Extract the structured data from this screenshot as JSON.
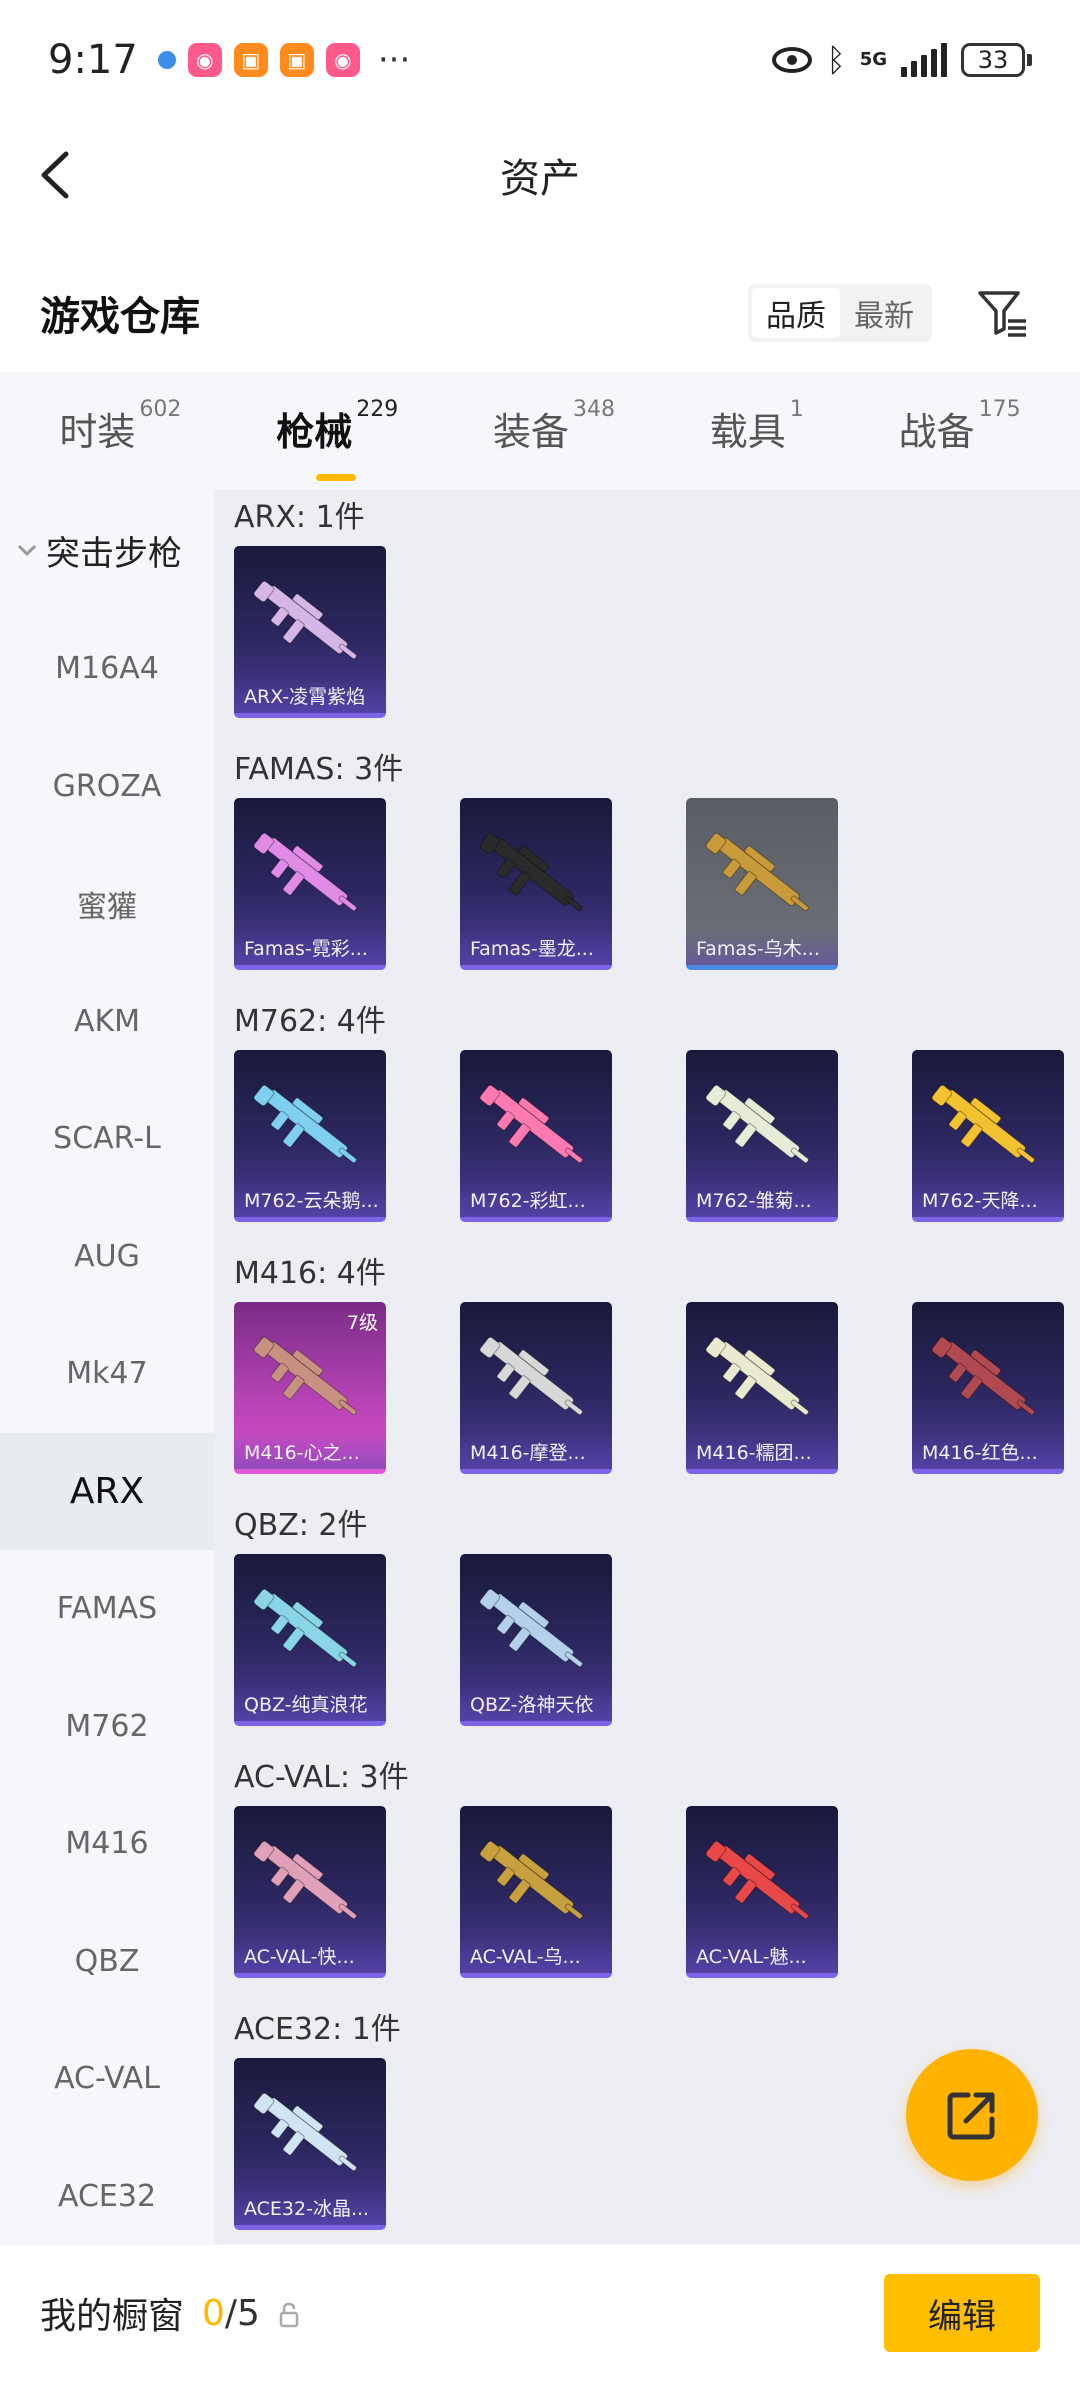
{
  "status_bar": {
    "time": "9:17",
    "network": "5G",
    "battery": "33",
    "more": "···"
  },
  "header": {
    "title": "资产"
  },
  "warehouse": {
    "title": "游戏仓库",
    "sort_options": [
      "品质",
      "最新"
    ],
    "active_sort": "品质"
  },
  "tabs": [
    {
      "label": "时装",
      "count": "602"
    },
    {
      "label": "枪械",
      "count": "229",
      "active": true
    },
    {
      "label": "装备",
      "count": "348"
    },
    {
      "label": "载具",
      "count": "1"
    },
    {
      "label": "战备",
      "count": "175"
    }
  ],
  "sidebar": {
    "header": "突击步枪",
    "items": [
      "M16A4",
      "GROZA",
      "蜜獾",
      "AKM",
      "SCAR-L",
      "AUG",
      "Mk47",
      "ARX",
      "FAMAS",
      "M762",
      "M416",
      "QBZ",
      "AC-VAL",
      "ACE32"
    ],
    "active": "ARX"
  },
  "groups": [
    {
      "title": "ARX: 1件",
      "cards": [
        {
          "label": "ARX-凌霄紫焰",
          "style": "purple",
          "gun_color": "#d6b6e6"
        }
      ]
    },
    {
      "title": "FAMAS: 3件",
      "cards": [
        {
          "label": "Famas-霓彩...",
          "style": "purple",
          "gun_color": "#e08be6"
        },
        {
          "label": "Famas-墨龙...",
          "style": "purple",
          "gun_color": "#2a2a2a"
        },
        {
          "label": "Famas-乌木...",
          "style": "gray",
          "gun_color": "#c89a3a"
        }
      ]
    },
    {
      "title": "M762: 4件",
      "cards": [
        {
          "label": "M762-云朵鹅...",
          "style": "purple",
          "gun_color": "#7fd0f0"
        },
        {
          "label": "M762-彩虹...",
          "style": "purple",
          "gun_color": "#ff7ab0"
        },
        {
          "label": "M762-雏菊...",
          "style": "purple",
          "gun_color": "#e6ecd8"
        },
        {
          "label": "M762-天降...",
          "style": "purple",
          "gun_color": "#f2c230"
        }
      ]
    },
    {
      "title": "M416: 4件",
      "cards": [
        {
          "label": "M416-心之...",
          "style": "pink",
          "gun_color": "#c89080",
          "level": "7级"
        },
        {
          "label": "M416-摩登...",
          "style": "purple",
          "gun_color": "#d8d8d8"
        },
        {
          "label": "M416-糯团...",
          "style": "purple",
          "gun_color": "#eaead0"
        },
        {
          "label": "M416-红色...",
          "style": "purple",
          "gun_color": "#b04a50"
        }
      ]
    },
    {
      "title": "QBZ: 2件",
      "cards": [
        {
          "label": "QBZ-纯真浪花",
          "style": "purple",
          "gun_color": "#8ad6e8"
        },
        {
          "label": "QBZ-洛神天依",
          "style": "purple",
          "gun_color": "#b4d0ec"
        }
      ]
    },
    {
      "title": "AC-VAL: 3件",
      "cards": [
        {
          "label": "AC-VAL-快...",
          "style": "purple",
          "gun_color": "#e0a0b8"
        },
        {
          "label": "AC-VAL-乌...",
          "style": "purple",
          "gun_color": "#c8a040"
        },
        {
          "label": "AC-VAL-魅...",
          "style": "purple",
          "gun_color": "#e84848"
        }
      ]
    },
    {
      "title": "ACE32: 1件",
      "cards": [
        {
          "label": "ACE32-冰晶...",
          "style": "purple",
          "gun_color": "#d0e4f4"
        }
      ]
    }
  ],
  "bottom_bar": {
    "label": "我的橱窗",
    "current": "0",
    "total": "/5",
    "edit_label": "编辑"
  },
  "colors": {
    "accent": "#ffb800",
    "card_border": "#7d63e6"
  }
}
